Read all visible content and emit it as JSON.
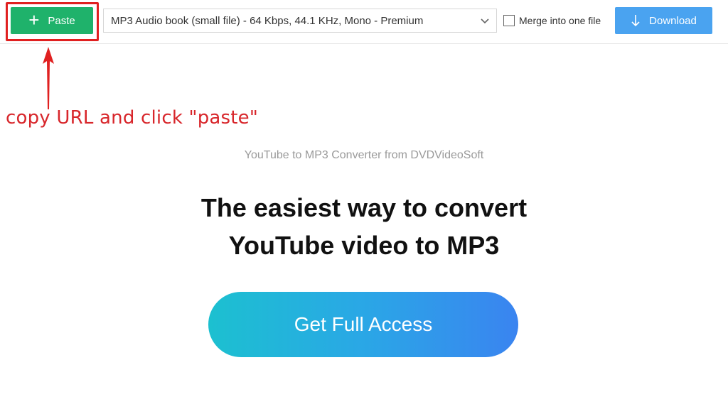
{
  "toolbar": {
    "paste_label": "Paste",
    "format_value": "MP3 Audio book (small file) - 64 Kbps, 44.1 KHz, Mono - Premium",
    "merge_label": "Merge into one file",
    "merge_checked": false,
    "download_label": "Download"
  },
  "annotation": {
    "text": "copy URL and click \"paste\"",
    "color": "#e02020"
  },
  "main": {
    "subtitle": "YouTube to MP3 Converter from DVDVideoSoft",
    "headline_line1": "The easiest way to convert",
    "headline_line2": "YouTube video to MP3",
    "cta_label": "Get Full Access"
  },
  "icons": {
    "paste": "plus-icon",
    "format": "chevron-down-icon",
    "download": "download-arrow-icon"
  },
  "colors": {
    "paste_button": "#1fb26b",
    "download_button": "#4aa3f0",
    "cta_gradient_start": "#1cc0d0",
    "cta_gradient_end": "#3a84f0"
  }
}
